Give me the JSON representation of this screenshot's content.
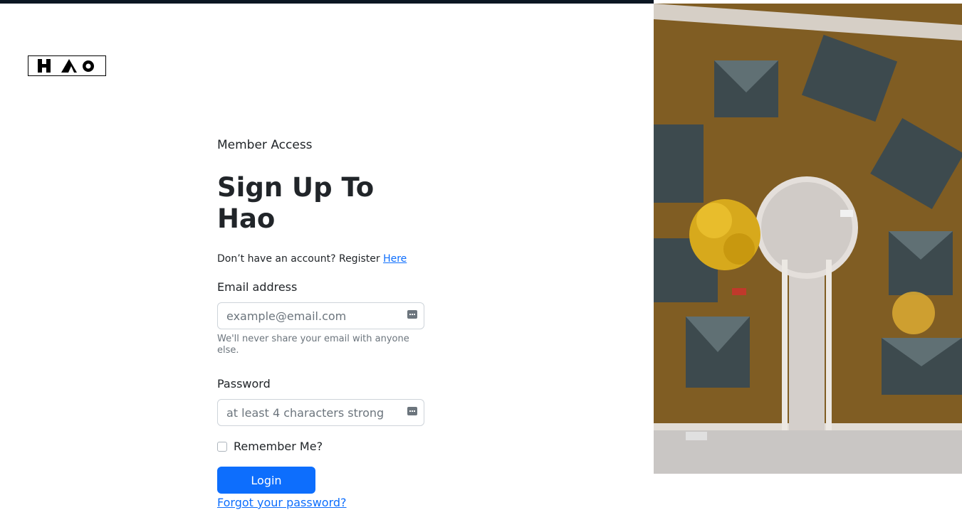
{
  "brand": {
    "logo_text": "HAO"
  },
  "form": {
    "eyebrow": "Member Access",
    "title": "Sign Up To Hao",
    "register_prompt": "Don’t have an account? Register",
    "register_link": "Here",
    "email": {
      "label": "Email address",
      "placeholder": "example@email.com",
      "value": "",
      "help": "We'll never share your email with anyone else."
    },
    "password": {
      "label": "Password",
      "placeholder": "at least 4 characters strong",
      "value": ""
    },
    "remember": {
      "label": "Remember Me?",
      "checked": false
    },
    "submit_label": "Login",
    "forgot_link": "Forgot your password?"
  },
  "colors": {
    "primary": "#0d6efd",
    "text": "#212529",
    "muted": "#6c757d",
    "border": "#ced4da"
  },
  "icons": {
    "field_icon": "password-manager-key-icon",
    "hero": "aerial-neighborhood-photo"
  }
}
